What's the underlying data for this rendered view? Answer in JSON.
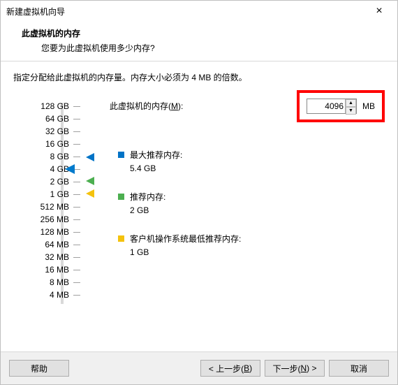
{
  "window": {
    "title": "新建虚拟机向导"
  },
  "header": {
    "title": "此虚拟机的内存",
    "subtitle": "您要为此虚拟机使用多少内存?"
  },
  "body": {
    "desc": "指定分配给此虚拟机的内存量。内存大小必须为 4 MB 的倍数。",
    "mem_label_pre": "此虚拟机的内存(",
    "mem_label_hot": "M",
    "mem_label_post": "):",
    "value": "4096",
    "unit": "MB",
    "ticks": [
      "128 GB",
      "64 GB",
      "32 GB",
      "16 GB",
      "8 GB",
      "4 GB",
      "2 GB",
      "1 GB",
      "512 MB",
      "256 MB",
      "128 MB",
      "64 MB",
      "32 MB",
      "16 MB",
      "8 MB",
      "4 MB"
    ],
    "legend": {
      "max": {
        "label": "最大推荐内存:",
        "value": "5.4 GB"
      },
      "rec": {
        "label": "推荐内存:",
        "value": "2 GB"
      },
      "min": {
        "label": "客户机操作系统最低推荐内存:",
        "value": "1 GB"
      }
    }
  },
  "buttons": {
    "help": "帮助",
    "back_pre": "< 上一步(",
    "back_hot": "B",
    "back_post": ")",
    "next_pre": "下一步(",
    "next_hot": "N",
    "next_post": ") >",
    "cancel": "取消"
  }
}
